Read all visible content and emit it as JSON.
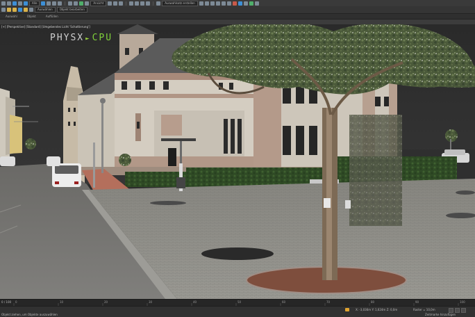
{
  "toolbar": {
    "selection_filter": "Alle",
    "view_dropdown": "Ansicht",
    "selection_set": "Auswahlsatz erstellen"
  },
  "toolbar2": {
    "item1": "Auswählen",
    "item2": "Objekt bearbeiten"
  },
  "ribbon": {
    "tabs": [
      "Auswahl",
      "Objekt",
      "Auffüllen"
    ]
  },
  "viewport": {
    "label": "[+] [Perspektive] [Standard] [Umgebendes Licht 'Schattierung']",
    "physx_left": "PHYSX",
    "physx_right": "CPU"
  },
  "timeline": {
    "frame_label": "0 / 100",
    "ticks": [
      "0",
      "10",
      "20",
      "30",
      "40",
      "50",
      "60",
      "70",
      "80",
      "90",
      "100"
    ]
  },
  "status": {
    "prompt": "Objekt ziehen, um Objekte auszuwählen",
    "x": "X: -3,036m",
    "y": "Y: 1,624m",
    "z": "Z: 0,0m",
    "grid": "Raster = 10,0m",
    "add_time": "Zeitmarke hinzufügen"
  },
  "colors": {
    "ui_bg": "#2b2b2b",
    "physx_accent": "#7fd03a",
    "toolbar_blue": "#3d8fd6"
  }
}
